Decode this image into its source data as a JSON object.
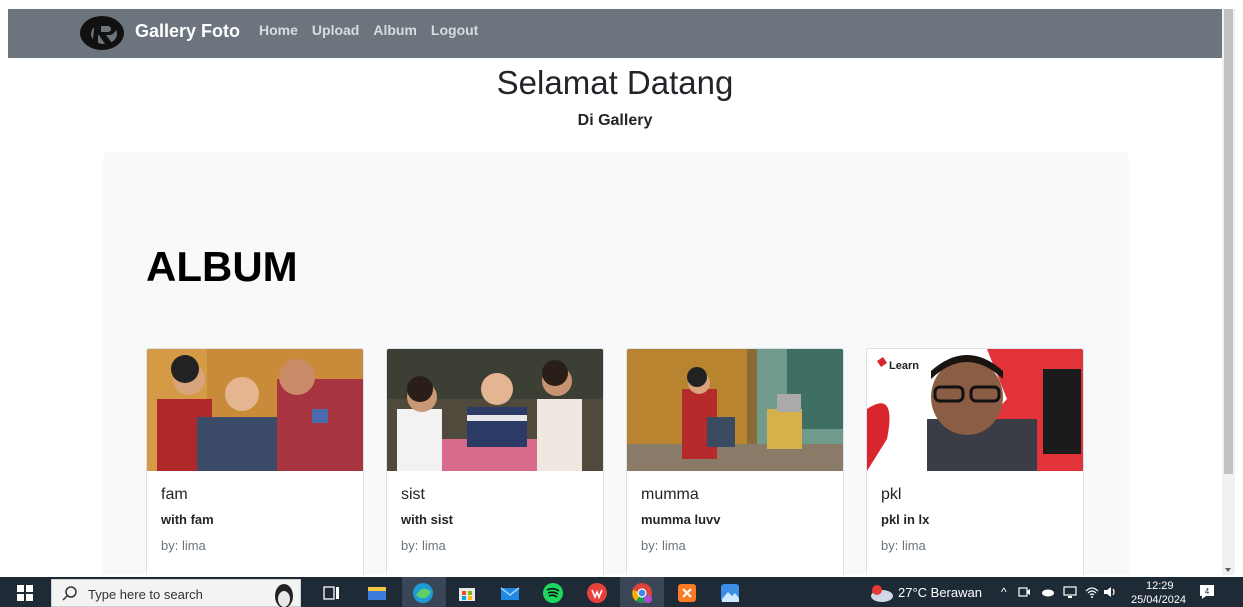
{
  "navbar": {
    "brand": "Gallery Foto",
    "links": [
      "Home",
      "Upload",
      "Album",
      "Logout"
    ]
  },
  "hero": {
    "title": "Selamat Datang",
    "subtitle": "Di Gallery"
  },
  "album": {
    "heading": "ALBUM",
    "cards": [
      {
        "title": "fam",
        "desc": "with fam",
        "by": "by: lima"
      },
      {
        "title": "sist",
        "desc": "with sist",
        "by": "by: lima"
      },
      {
        "title": "mumma",
        "desc": "mumma luvv",
        "by": "by: lima"
      },
      {
        "title": "pkl",
        "desc": "pkl in lx",
        "by": "by: lima"
      }
    ],
    "card4_photo_caption": "Learn"
  },
  "taskbar": {
    "search_placeholder": "Type here to search",
    "weather": "27°C  Berawan",
    "time": "12:29",
    "date": "25/04/2024",
    "notifications": "4"
  },
  "colors": {
    "navbar": "#6c757d",
    "jumbotron": "#f8f9fa",
    "primary": "#0d6efd",
    "danger": "#dc3545",
    "taskbar": "#1f2a37"
  }
}
